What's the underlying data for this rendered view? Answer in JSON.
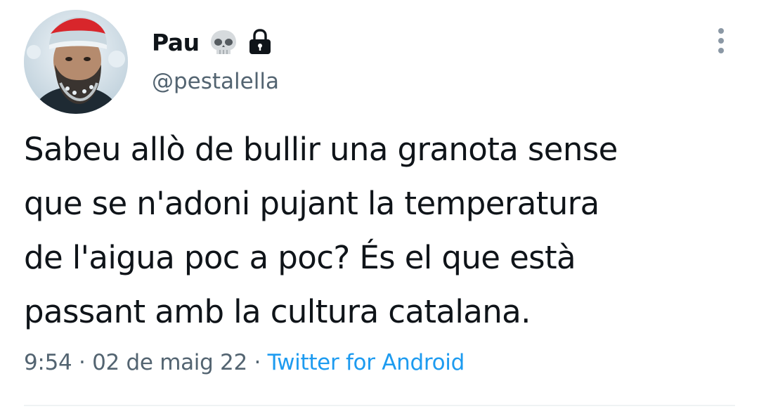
{
  "author": {
    "display_name": "Pau",
    "handle": "@pestalella",
    "name_emoji_icon": "skull-icon",
    "protected_icon": "lock-icon",
    "avatar_icon": "user-avatar"
  },
  "tweet": {
    "text_lines": [
      "Sabeu allò de bullir una granota sense",
      "que se n'adoni pujant la temperatura",
      "de l'aigua poc a poc? És el que està",
      "passant amb la cultura catalana."
    ]
  },
  "meta": {
    "time": "9:54",
    "separator": "·",
    "date": "02 de maig 22",
    "source": "Twitter for Android"
  },
  "colors": {
    "text_primary": "#0f1419",
    "text_secondary": "#536471",
    "link": "#1d9bf0",
    "divider": "#eff3f4"
  },
  "actions": {
    "more_icon": "more-vertical-icon"
  }
}
